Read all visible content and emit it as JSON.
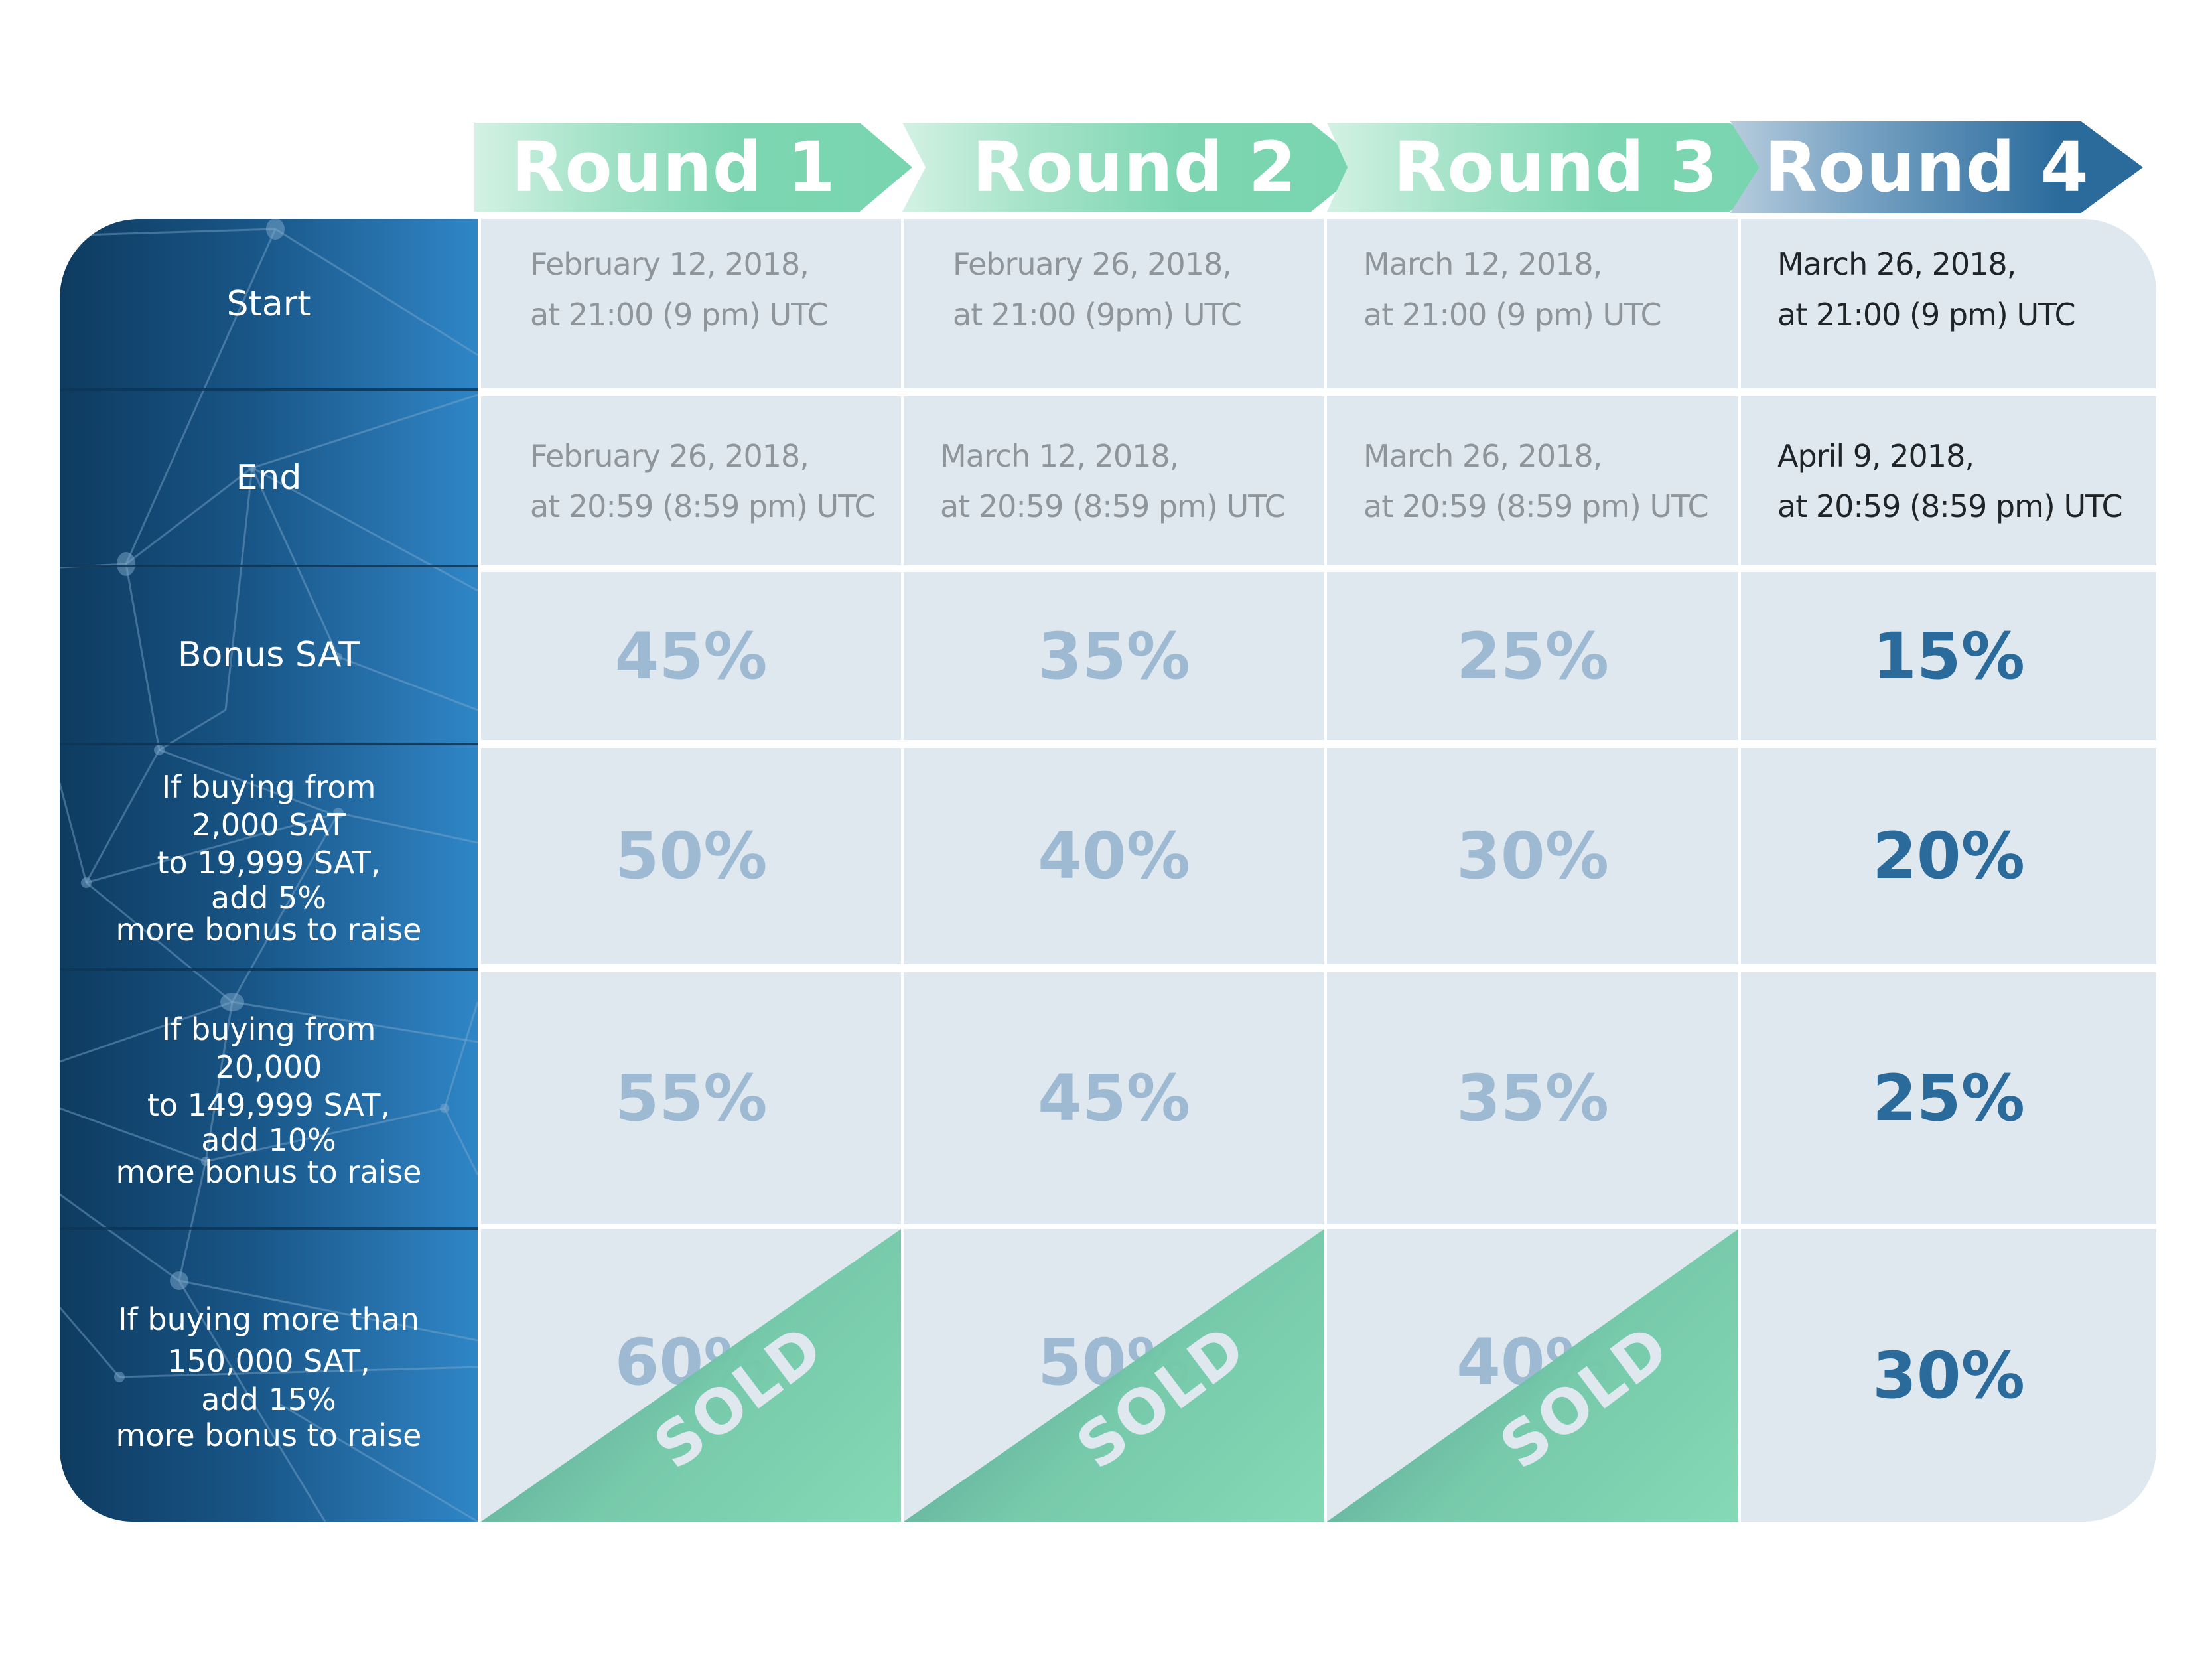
{
  "rounds": [
    {
      "label": "Round 1",
      "status": "sold"
    },
    {
      "label": "Round 2",
      "status": "sold"
    },
    {
      "label": "Round 3",
      "status": "sold"
    },
    {
      "label": "Round 4",
      "status": "active"
    }
  ],
  "row_labels": {
    "start": "Start",
    "end": "End",
    "bonus": "Bonus SAT",
    "tier1": [
      "If buying from",
      "2,000 SAT",
      "to 19,999 SAT,",
      "add 5%",
      "more bonus to raise"
    ],
    "tier2": [
      "If buying from",
      "20,000",
      "to 149,999 SAT,",
      "add 10%",
      "more bonus to raise"
    ],
    "tier3": [
      "If buying more than",
      "150,000  SAT,",
      "add 15%",
      "more bonus to raise"
    ]
  },
  "start": [
    [
      "February 12, 2018,",
      "at 21:00 (9 pm) UTC"
    ],
    [
      "February 26, 2018,",
      "at 21:00 (9pm) UTC"
    ],
    [
      "March 12, 2018,",
      "at 21:00 (9 pm) UTC"
    ],
    [
      "March 26, 2018,",
      "at 21:00 (9 pm) UTC"
    ]
  ],
  "end": [
    [
      "February 26, 2018,",
      "at 20:59 (8:59 pm) UTC"
    ],
    [
      "March 12, 2018,",
      "at 20:59 (8:59 pm) UTC"
    ],
    [
      "March 26, 2018,",
      "at 20:59 (8:59 pm) UTC"
    ],
    [
      "April 9, 2018,",
      "at 20:59 (8:59 pm) UTC"
    ]
  ],
  "bonus": [
    "45%",
    "35%",
    "25%",
    "15%"
  ],
  "tier1": [
    "50%",
    "40%",
    "30%",
    "20%"
  ],
  "tier2": [
    "55%",
    "45%",
    "35%",
    "25%"
  ],
  "tier3": [
    "60%",
    "50%",
    "40%",
    "30%"
  ],
  "sold_label": "SOLD",
  "colors": {
    "active_text": "#2a6b9c",
    "past_text": "#9ebad2",
    "sold_green": "#78d5af",
    "panel_blue": "#185586",
    "cell_bg": "#dfe8ef"
  }
}
